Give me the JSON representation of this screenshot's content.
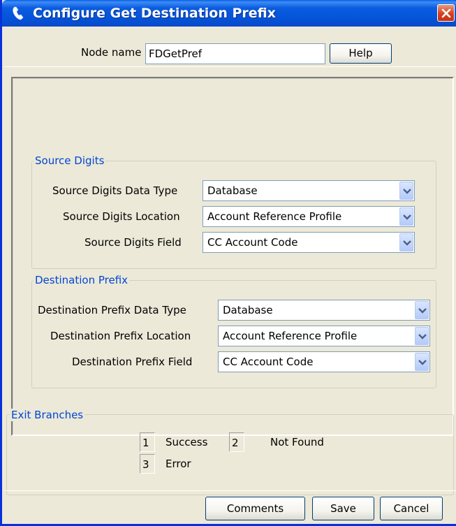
{
  "window": {
    "title": "Configure Get Destination Prefix",
    "icon": "phone-handset-icon",
    "close": "close-icon"
  },
  "node": {
    "label": "Node name",
    "value": "FDGetPref",
    "help_label": "Help"
  },
  "source_digits": {
    "legend": "Source Digits",
    "rows": [
      {
        "label": "Source Digits Data Type",
        "value": "Database"
      },
      {
        "label": "Source Digits Location",
        "value": "Account Reference Profile"
      },
      {
        "label": "Source Digits Field",
        "value": "CC Account Code"
      }
    ]
  },
  "destination_prefix": {
    "legend": "Destination Prefix",
    "rows": [
      {
        "label": "Destination Prefix Data Type",
        "value": "Database"
      },
      {
        "label": "Destination Prefix Location",
        "value": "Account Reference Profile"
      },
      {
        "label": "Destination Prefix Field",
        "value": "CC Account Code"
      }
    ]
  },
  "exit_branches": {
    "legend": "Exit Branches",
    "items": [
      {
        "number": "1",
        "label": "Success"
      },
      {
        "number": "2",
        "label": "Not Found"
      },
      {
        "number": "3",
        "label": "Error"
      }
    ]
  },
  "footer": {
    "comments_label": "Comments",
    "save_label": "Save",
    "cancel_label": "Cancel"
  },
  "colors": {
    "titlebar": "#0553d8",
    "group_legend": "#0046d5",
    "close_button": "#d5411f"
  }
}
